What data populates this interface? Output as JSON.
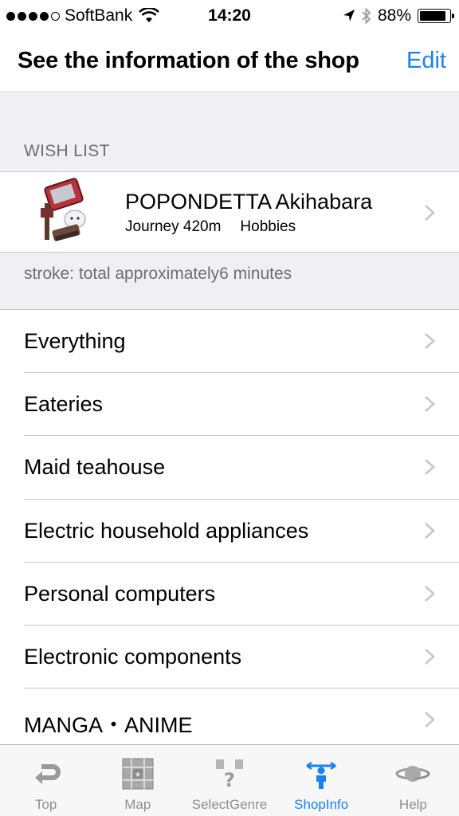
{
  "status_bar": {
    "carrier": "SoftBank",
    "time": "14:20",
    "battery": "88%",
    "battery_level": 0.88,
    "signal_icons": [
      "location-arrow-icon",
      "bluetooth-icon",
      "wifi-icon"
    ]
  },
  "nav": {
    "title": "See the information of the shop",
    "edit_label": "Edit"
  },
  "wish_list": {
    "header": "WISH LIST",
    "item": {
      "name": "POPONDETTA Akihabara",
      "distance": "Journey 420m",
      "genre": "Hobbies"
    },
    "footer": "stroke: total approximately6 minutes"
  },
  "genres": [
    {
      "label": "Everything"
    },
    {
      "label": "Eateries"
    },
    {
      "label": "Maid teahouse"
    },
    {
      "label": "Electric household appliances"
    },
    {
      "label": "Personal computers"
    },
    {
      "label": "Electronic components"
    },
    {
      "label": "MANGA・ANIME"
    }
  ],
  "tab_bar": {
    "tabs": [
      {
        "label": "Top",
        "icon": "return-arrow-icon"
      },
      {
        "label": "Map",
        "icon": "map-icon"
      },
      {
        "label": "SelectGenre",
        "icon": "genre-question-icon"
      },
      {
        "label": "ShopInfo",
        "icon": "shop-info-person-icon",
        "active": true
      },
      {
        "label": "Help",
        "icon": "planet-icon"
      }
    ]
  },
  "colors": {
    "accent": "#1a82f7",
    "group_bg": "#efeff4",
    "secondary_text": "#6d6d72"
  }
}
